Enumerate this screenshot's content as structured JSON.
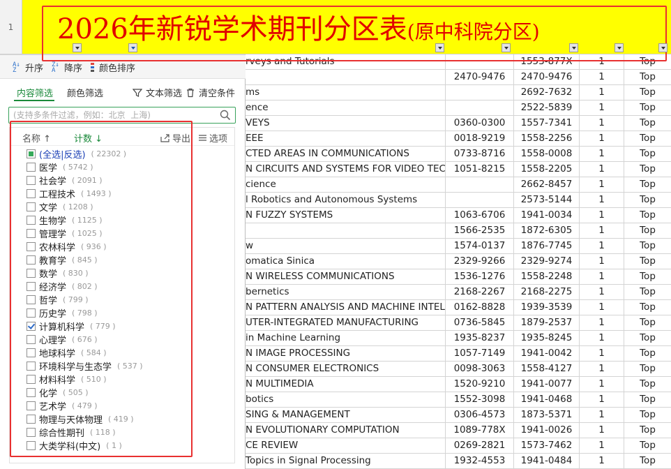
{
  "row_number": "1",
  "title": {
    "main": "2026年新锐学术期刊分区表",
    "sub": "(原中科院分区)"
  },
  "sort_bar": {
    "asc": "升序",
    "desc": "降序",
    "color": "颜色排序"
  },
  "tabs": {
    "content": "内容筛选",
    "color": "颜色筛选",
    "text_filter": "文本筛选",
    "clear": "清空条件"
  },
  "search": {
    "placeholder": "(支持多条件过滤，例如：北京  上海)"
  },
  "list_header": {
    "name": "名称",
    "count": "计数",
    "export": "导出",
    "options": "选项"
  },
  "items": [
    {
      "name": "(全选|反选)",
      "count": "( 22302 )",
      "state": "partial"
    },
    {
      "name": "医学",
      "count": "( 5742 )",
      "state": "unchecked"
    },
    {
      "name": "社会学",
      "count": "( 2091 )",
      "state": "unchecked"
    },
    {
      "name": "工程技术",
      "count": "( 1493 )",
      "state": "unchecked"
    },
    {
      "name": "文学",
      "count": "( 1208 )",
      "state": "unchecked"
    },
    {
      "name": "生物学",
      "count": "( 1125 )",
      "state": "unchecked"
    },
    {
      "name": "管理学",
      "count": "( 1025 )",
      "state": "unchecked"
    },
    {
      "name": "农林科学",
      "count": "( 936 )",
      "state": "unchecked"
    },
    {
      "name": "教育学",
      "count": "( 845 )",
      "state": "unchecked"
    },
    {
      "name": "数学",
      "count": "( 830 )",
      "state": "unchecked"
    },
    {
      "name": "经济学",
      "count": "( 802 )",
      "state": "unchecked"
    },
    {
      "name": "哲学",
      "count": "( 799 )",
      "state": "unchecked"
    },
    {
      "name": "历史学",
      "count": "( 798 )",
      "state": "unchecked"
    },
    {
      "name": "计算机科学",
      "count": "( 779 )",
      "state": "checked"
    },
    {
      "name": "心理学",
      "count": "( 676 )",
      "state": "unchecked"
    },
    {
      "name": "地球科学",
      "count": "( 584 )",
      "state": "unchecked"
    },
    {
      "name": "环境科学与生态学",
      "count": "( 537 )",
      "state": "unchecked"
    },
    {
      "name": "材料科学",
      "count": "( 510 )",
      "state": "unchecked"
    },
    {
      "name": "化学",
      "count": "( 505 )",
      "state": "unchecked"
    },
    {
      "name": "艺术学",
      "count": "( 479 )",
      "state": "unchecked"
    },
    {
      "name": "物理与天体物理",
      "count": "( 419 )",
      "state": "unchecked"
    },
    {
      "name": "综合性期刊",
      "count": "( 118 )",
      "state": "unchecked"
    },
    {
      "name": "大类学科(中文)",
      "count": "( 1 )",
      "state": "unchecked"
    }
  ],
  "rows": [
    [
      "rveys and Tutorials",
      "",
      "1553-877X",
      "1",
      "Top"
    ],
    [
      "",
      "2470-9476",
      "2470-9476",
      "1",
      "Top"
    ],
    [
      "ms",
      "",
      "2692-7632",
      "1",
      "Top"
    ],
    [
      "ence",
      "",
      "2522-5839",
      "1",
      "Top"
    ],
    [
      "VEYS",
      "0360-0300",
      "1557-7341",
      "1",
      "Top"
    ],
    [
      "EEE",
      "0018-9219",
      "1558-2256",
      "1",
      "Top"
    ],
    [
      "CTED AREAS IN COMMUNICATIONS",
      "0733-8716",
      "1558-0008",
      "1",
      "Top"
    ],
    [
      "N CIRCUITS AND SYSTEMS FOR VIDEO TECHN",
      "1051-8215",
      "1558-2205",
      "1",
      "Top"
    ],
    [
      "cience",
      "",
      "2662-8457",
      "1",
      "Top"
    ],
    [
      "l Robotics and Autonomous Systems",
      "",
      "2573-5144",
      "1",
      "Top"
    ],
    [
      "N FUZZY SYSTEMS",
      "1063-6706",
      "1941-0034",
      "1",
      "Top"
    ],
    [
      "",
      "1566-2535",
      "1872-6305",
      "1",
      "Top"
    ],
    [
      "w",
      "1574-0137",
      "1876-7745",
      "1",
      "Top"
    ],
    [
      "omatica Sinica",
      "2329-9266",
      "2329-9274",
      "1",
      "Top"
    ],
    [
      "N WIRELESS COMMUNICATIONS",
      "1536-1276",
      "1558-2248",
      "1",
      "Top"
    ],
    [
      "bernetics",
      "2168-2267",
      "2168-2275",
      "1",
      "Top"
    ],
    [
      "N PATTERN ANALYSIS AND MACHINE INTELLI",
      "0162-8828",
      "1939-3539",
      "1",
      "Top"
    ],
    [
      "UTER-INTEGRATED MANUFACTURING",
      "0736-5845",
      "1879-2537",
      "1",
      "Top"
    ],
    [
      " in Machine Learning",
      "1935-8237",
      "1935-8245",
      "1",
      "Top"
    ],
    [
      "N IMAGE PROCESSING",
      "1057-7149",
      "1941-0042",
      "1",
      "Top"
    ],
    [
      "N CONSUMER ELECTRONICS",
      "0098-3063",
      "1558-4127",
      "1",
      "Top"
    ],
    [
      "N MULTIMEDIA",
      "1520-9210",
      "1941-0077",
      "1",
      "Top"
    ],
    [
      "botics",
      "1552-3098",
      "1941-0468",
      "1",
      "Top"
    ],
    [
      "SING & MANAGEMENT",
      "0306-4573",
      "1873-5371",
      "1",
      "Top"
    ],
    [
      "N EVOLUTIONARY COMPUTATION",
      "1089-778X",
      "1941-0026",
      "1",
      "Top"
    ],
    [
      "CE REVIEW",
      "0269-2821",
      "1573-7462",
      "1",
      "Top"
    ],
    [
      " Topics in Signal Processing",
      "1932-4553",
      "1941-0484",
      "1",
      "Top"
    ]
  ]
}
